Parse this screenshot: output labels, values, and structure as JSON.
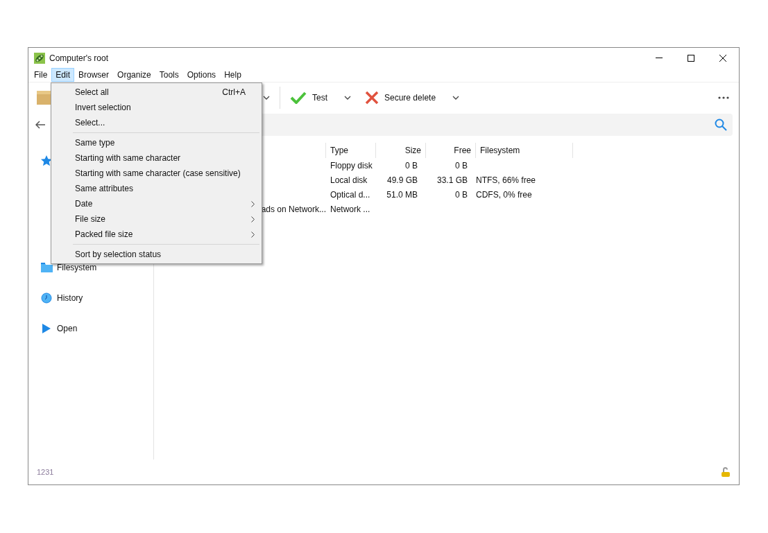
{
  "window": {
    "title": "Computer's root"
  },
  "menu_bar": [
    {
      "label": "File",
      "selected": false
    },
    {
      "label": "Edit",
      "selected": true
    },
    {
      "label": "Browser",
      "selected": false
    },
    {
      "label": "Organize",
      "selected": false
    },
    {
      "label": "Tools",
      "selected": false
    },
    {
      "label": "Options",
      "selected": false
    },
    {
      "label": "Help",
      "selected": false
    }
  ],
  "toolbar": [
    {
      "kind": "check",
      "label": "Test"
    },
    {
      "kind": "cross",
      "label": "Secure delete"
    }
  ],
  "sidebar": [
    {
      "kind": "star"
    },
    {
      "kind": "folder",
      "label": "Filesystem"
    },
    {
      "kind": "history",
      "label": "History"
    },
    {
      "kind": "play",
      "label": "Open"
    }
  ],
  "table": {
    "columns": [
      "Type",
      "Size",
      "Free",
      "Filesystem"
    ],
    "rows": [
      {
        "cells": [
          "Floppy disk",
          "0 B",
          "0 B",
          ""
        ]
      },
      {
        "cells": [
          "Local disk",
          "49.9 GB",
          "33.1 GB",
          "NTFS, 66% free"
        ]
      },
      {
        "cells": [
          "Optical d...",
          "51.0 MB",
          "0 B",
          "CDFS, 0% free"
        ]
      },
      {
        "name": "ads on Network...",
        "cells": [
          "Network ...",
          "",
          "",
          ""
        ]
      }
    ]
  },
  "status_bar": {
    "count": "1231"
  },
  "edit_menu": [
    {
      "kind": "item",
      "label": "Select all",
      "shortcut": "Ctrl+A"
    },
    {
      "kind": "item",
      "label": "Invert selection"
    },
    {
      "kind": "item",
      "label": "Select..."
    },
    {
      "kind": "separator"
    },
    {
      "kind": "item",
      "label": "Same type"
    },
    {
      "kind": "item",
      "label": "Starting with same character"
    },
    {
      "kind": "item",
      "label": "Starting with same character (case sensitive)"
    },
    {
      "kind": "item",
      "label": "Same attributes"
    },
    {
      "kind": "submenu",
      "label": "Date"
    },
    {
      "kind": "submenu",
      "label": "File size"
    },
    {
      "kind": "submenu",
      "label": "Packed file size"
    },
    {
      "kind": "separator"
    },
    {
      "kind": "item",
      "label": "Sort by selection status"
    }
  ]
}
